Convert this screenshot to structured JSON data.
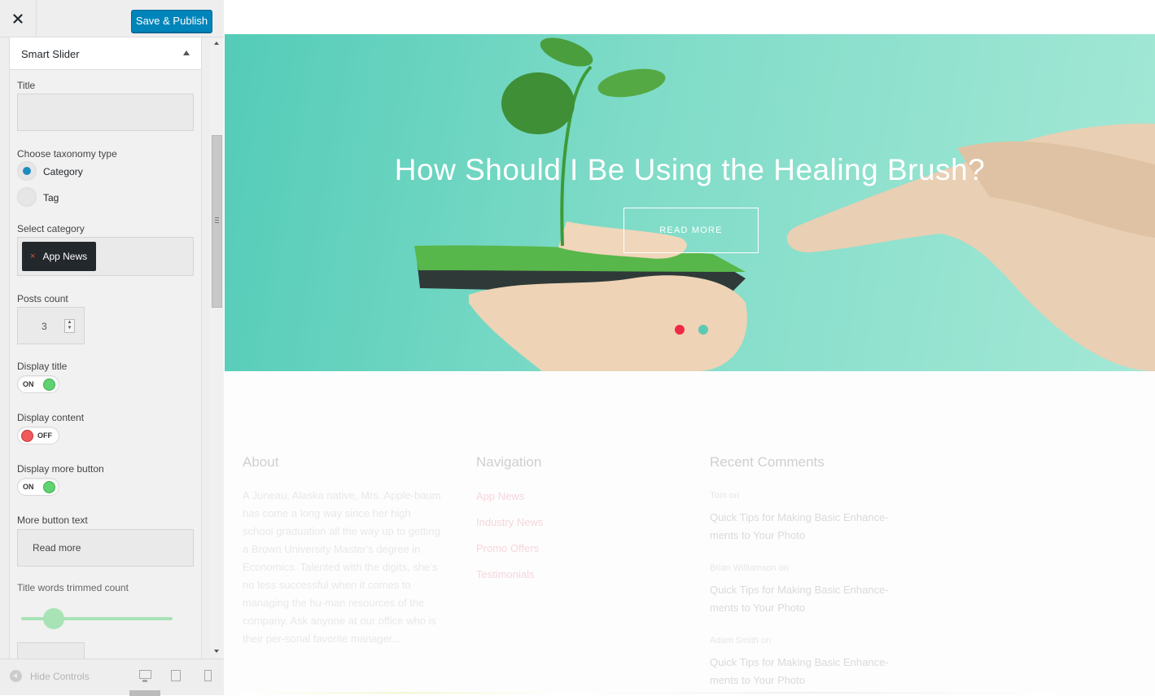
{
  "topbar": {
    "close_icon": "close-icon",
    "publish_label": "Save & Publish",
    "publish_color": "#0085ba"
  },
  "section": {
    "title": "Smart Slider",
    "arrow_icon": "caret-up-icon"
  },
  "fields": {
    "title_label": "Title",
    "title_value": "",
    "taxonomy_label": "Choose taxonomy type",
    "taxonomy_options": [
      {
        "label": "Category",
        "selected": true
      },
      {
        "label": "Tag",
        "selected": false
      }
    ],
    "category_label": "Select category",
    "category_chip": "App News",
    "category_chip_remove": "×",
    "posts_count_label": "Posts count",
    "posts_count_value": "3",
    "display_title_label": "Display title",
    "display_title_state": "ON",
    "display_content_label": "Display content",
    "display_content_state": "OFF",
    "display_more_label": "Display more button",
    "display_more_state": "ON",
    "more_text_label": "More button text",
    "more_text_value": "Read more",
    "trim_label": "Title words trimmed count"
  },
  "footer_controls": {
    "hide_label": "Hide Controls",
    "hide_icon": "collapse-arrow-icon",
    "devices": [
      "desktop-icon",
      "tablet-icon",
      "mobile-icon"
    ]
  },
  "hero": {
    "title": "How Should I Be Using the Healing Brush?",
    "button": "READ MORE",
    "active_dot_color": "#ee2b47",
    "dot_color": "#5cc9b3"
  },
  "site_footer": {
    "about": {
      "title": "About",
      "text": "A Juneau, Alaska native, Mrs. Apple-baum has come a long way since her high school graduation all the way up to getting a Brown University Master's degree in Economics. Talented with the digits, she's no less successful when it comes to managing the hu-man resources of the company. Ask anyone at our office who is their per-sonal favorite manager..."
    },
    "navigation": {
      "title": "Navigation",
      "links": [
        "App News",
        "Industry News",
        "Promo Offers",
        "Testimonials"
      ]
    },
    "comments": {
      "title": "Recent Comments",
      "items": [
        {
          "author": "Tom  on",
          "text": "Quick Tips for Making Basic Enhance-ments to Your Photo"
        },
        {
          "author": "Brian Williamson  on",
          "text": "Quick Tips for Making Basic Enhance-ments to Your Photo"
        },
        {
          "author": "Adam Smith  on",
          "text": "Quick Tips for Making Basic Enhance-ments to Your Photo"
        }
      ]
    }
  }
}
